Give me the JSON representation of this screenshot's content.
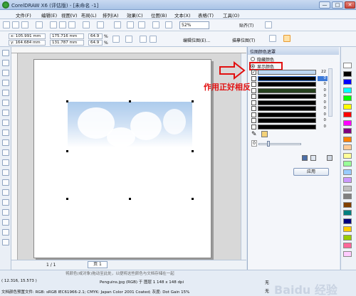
{
  "window": {
    "title": "CorelDRAW X6 (评估版) - [未命名 -1]",
    "min_glyph": "—",
    "max_glyph": "□",
    "close_glyph": "✕"
  },
  "menu": [
    "文件(F)",
    "编辑(E)",
    "视图(V)",
    "布局(L)",
    "排列(A)",
    "效果(C)",
    "位图(B)",
    "文本(X)",
    "表格(T)",
    "工具(O)"
  ],
  "toolbar": {
    "zoom_value": "52%",
    "snap_label": "贴齐(T)"
  },
  "property_bar": {
    "x_value": "x: 105.991 mm",
    "y_value": "y: 164.684 mm",
    "w_value": "175.716 mm",
    "h_value": "131.787 mm",
    "scale_w": "64.9",
    "scale_h": "64.9",
    "scale_unit": "%",
    "edit_bitmap_label": "编辑位图(E)...",
    "trace_bitmap_label": "描摹位图(T)"
  },
  "docker": {
    "title": "位图颜色遮罩",
    "hide_colors_label": "隐藏颜色",
    "show_colors_label": "显示颜色",
    "rows": [
      {
        "checked": true,
        "color": "#bcd6f2",
        "count": "22",
        "selected": false
      },
      {
        "checked": false,
        "color": "#000000",
        "count": "0",
        "selected": true
      },
      {
        "checked": false,
        "color": "#000000",
        "count": "0",
        "selected": false
      },
      {
        "checked": false,
        "color": "#25401d",
        "count": "0",
        "selected": false
      },
      {
        "checked": false,
        "color": "#000000",
        "count": "0",
        "selected": false
      },
      {
        "checked": false,
        "color": "#000000",
        "count": "0",
        "selected": false
      },
      {
        "checked": false,
        "color": "#000000",
        "count": "0",
        "selected": false
      },
      {
        "checked": false,
        "color": "#000000",
        "count": "0",
        "selected": false
      },
      {
        "checked": false,
        "color": "#000000",
        "count": "0",
        "selected": false
      },
      {
        "checked": false,
        "color": "#000000",
        "count": "0",
        "selected": false
      }
    ],
    "tolerance_value": "0",
    "apply_label": "应用"
  },
  "page_nav": {
    "page_count": "1 / 1",
    "page_tab": "页 1"
  },
  "hint": "将颜色(或对象)拖动至此处，以便将这些颜色与文档存储在一起",
  "status": {
    "coords": "( 12.316, 15.573 )",
    "object_info": "Penguins.jpg (RGB) 于 图层 1 148 x 148 dpi",
    "profile_info": "文档颜色预置文件: RGB: sRGB IEC61966-2.1; CMYK: Japan Color 2001 Coated; 灰度: Dot Gain 15%",
    "fill_none": "无",
    "outline_none": "无"
  },
  "annotation": {
    "text": "作用正好相反",
    "color": "#e21010"
  },
  "palette_colors": [
    "#ffffff",
    "#000000",
    "#0000ff",
    "#00ffff",
    "#00ff00",
    "#ffff00",
    "#ff0000",
    "#ff00ff",
    "#800080",
    "#ff8000",
    "#ffcc99",
    "#ffff99",
    "#99ff99",
    "#99ccff",
    "#cc99ff",
    "#c0c0c0",
    "#808080",
    "#804000",
    "#008080",
    "#000080",
    "#ffcc00",
    "#99cc00",
    "#ff6699",
    "#ffccff"
  ],
  "watermark": "Baidu 经验"
}
